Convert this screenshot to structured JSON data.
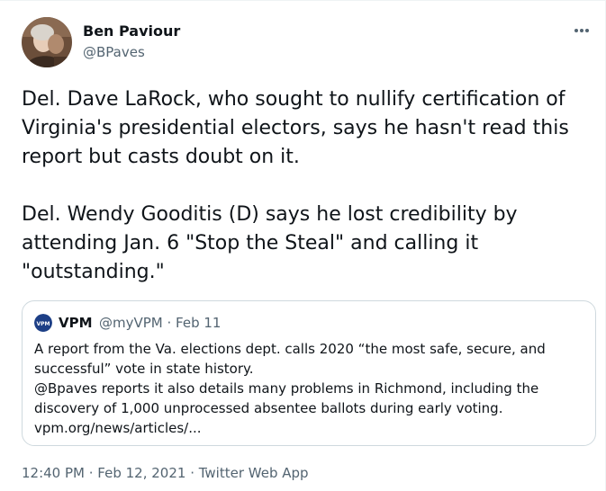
{
  "author": {
    "name": "Ben Paviour",
    "handle": "@BPaves",
    "avatar_icon": "profile-photo"
  },
  "more_icon": "ellipsis-icon",
  "tweet_text": "Del. Dave LaRock, who sought to nullify certification of\nVirginia's presidential electors, says he hasn't read this\nreport but casts doubt on it.\n\nDel. Wendy Gooditis (D) says he lost credibility by\nattending Jan. 6 \"Stop the Steal\" and calling it\n\"outstanding.\"",
  "quoted_tweet": {
    "logo_text": "VPM",
    "name": "VPM",
    "meta": "@myVPM · Feb 11",
    "text": "A report from the Va. elections dept. calls 2020 “the most safe, secure, and\nsuccessful” vote in state history.\n@Bpaves reports it also details many problems in Richmond, including the\ndiscovery of 1,000 unprocessed absentee ballots during early voting.\nvpm.org/news/articles/..."
  },
  "footer": {
    "time": "12:40 PM",
    "separator1": " · ",
    "date": "Feb 12, 2021",
    "separator2": " · ",
    "source": "Twitter Web App"
  },
  "colors": {
    "text": "#0f1419",
    "secondary": "#536471",
    "border": "#cfd9de",
    "vpm_blue": "#1d3f86"
  }
}
